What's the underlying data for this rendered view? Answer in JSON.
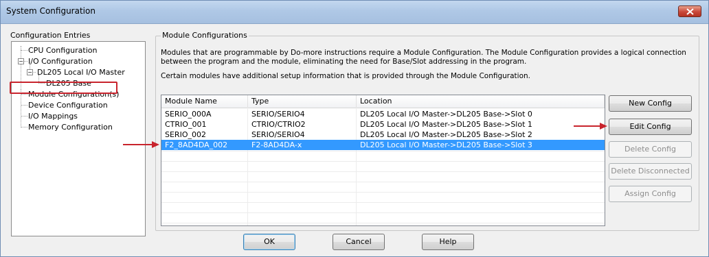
{
  "window": {
    "title": "System Configuration"
  },
  "tree": {
    "group_label": "Configuration Entries",
    "items": [
      {
        "label": "CPU Configuration"
      },
      {
        "label": "I/O Configuration",
        "expander": "-"
      },
      {
        "label": "DL205 Local I/O Master",
        "expander": "-"
      },
      {
        "label": "DL205 Base"
      },
      {
        "label": "Module Configuration(s)"
      },
      {
        "label": "Device Configuration"
      },
      {
        "label": "I/O Mappings"
      },
      {
        "label": "Memory Configuration"
      }
    ]
  },
  "module_config": {
    "group_label": "Module Configurations",
    "description_line1": "Modules that are programmable by Do-more instructions require a Module Configuration. The Module Configuration provides a logical connection",
    "description_line2": "between the program and the module, eliminating the need for Base/Slot addressing in the program.",
    "description_line3": "Certain modules have additional setup information that is provided through the Module Configuration.",
    "columns": [
      "Module Name",
      "Type",
      "Location"
    ],
    "rows": [
      {
        "name": "SERIO_000A",
        "type": "SERIO/SERIO4",
        "location": "DL205 Local I/O Master->DL205 Base->Slot 0"
      },
      {
        "name": "CTRIO_001",
        "type": "CTRIO/CTRIO2",
        "location": "DL205 Local I/O Master->DL205 Base->Slot 1"
      },
      {
        "name": "SERIO_002",
        "type": "SERIO/SERIO4",
        "location": "DL205 Local I/O Master->DL205 Base->Slot 2"
      },
      {
        "name": "F2_8AD4DA_002",
        "type": "F2-8AD4DA-x",
        "location": "DL205 Local I/O Master->DL205 Base->Slot 3"
      }
    ],
    "selected_row": 3
  },
  "side_buttons": {
    "new_config": "New Config",
    "edit_config": "Edit Config",
    "delete_config": "Delete Config",
    "delete_disconnected": "Delete Disconnected",
    "assign_config": "Assign Config"
  },
  "bottom_buttons": {
    "ok": "OK",
    "cancel": "Cancel",
    "help": "Help"
  },
  "colors": {
    "annotation_red": "#c8232c",
    "selection_blue": "#3399ff"
  },
  "icons": [
    "close-icon",
    "arrow-right-icon"
  ]
}
